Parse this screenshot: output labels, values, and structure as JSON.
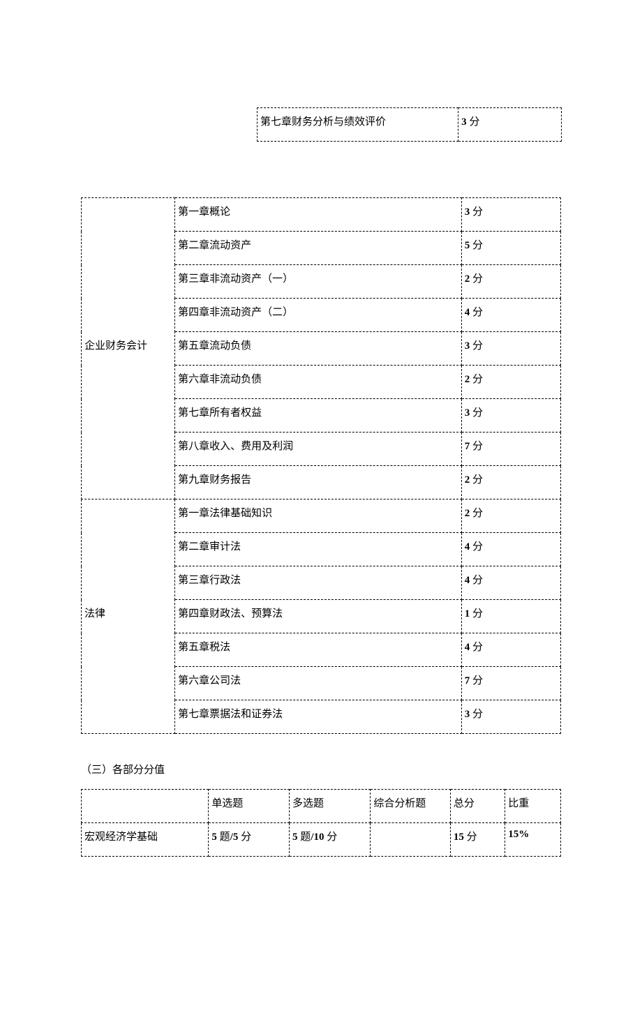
{
  "table1": {
    "rows": [
      {
        "chapter": "第七章财务分析与绩效评价",
        "score_num": "3",
        "score_suffix": " 分"
      }
    ]
  },
  "table2": {
    "section_a": {
      "category": "企业财务会计",
      "rows": [
        {
          "chapter": "第一章概论",
          "score_num": "3",
          "score_suffix": " 分"
        },
        {
          "chapter": "第二章流动资产",
          "score_num": "5",
          "score_suffix": " 分"
        },
        {
          "chapter": "第三章非流动资产（一）",
          "score_num": "2",
          "score_suffix": " 分"
        },
        {
          "chapter": "第四章非流动资产（二）",
          "score_num": "4",
          "score_suffix": " 分"
        },
        {
          "chapter": "第五章流动负债",
          "score_num": "3",
          "score_suffix": " 分"
        },
        {
          "chapter": "第六章非流动负债",
          "score_num": "2",
          "score_suffix": " 分"
        },
        {
          "chapter": "第七章所有者权益",
          "score_num": "3",
          "score_suffix": " 分"
        },
        {
          "chapter": "第八章收入、费用及利润",
          "score_num": "7",
          "score_suffix": " 分"
        },
        {
          "chapter": "第九章财务报告",
          "score_num": "2",
          "score_suffix": " 分"
        }
      ]
    },
    "section_b": {
      "category": "法律",
      "rows": [
        {
          "chapter": "第一章法律基础知识",
          "score_num": "2",
          "score_suffix": " 分"
        },
        {
          "chapter": "第二章审计法",
          "score_num": "4",
          "score_suffix": " 分"
        },
        {
          "chapter": "第三章行政法",
          "score_num": "4",
          "score_suffix": " 分"
        },
        {
          "chapter": "第四章财政法、预算法",
          "score_num": "1",
          "score_suffix": " 分"
        },
        {
          "chapter": "第五章税法",
          "score_num": "4",
          "score_suffix": " 分"
        },
        {
          "chapter": "第六章公司法",
          "score_num": "7",
          "score_suffix": " 分"
        },
        {
          "chapter": "第七章票据法和证券法",
          "score_num": "3",
          "score_suffix": " 分"
        }
      ]
    }
  },
  "section3": {
    "heading": "（三）各部分分值",
    "header": {
      "c0": "",
      "c1": "单选题",
      "c2": "多选题",
      "c3": "综合分析题",
      "c4": "总分",
      "c5": "比重"
    },
    "rows": [
      {
        "c0": "宏观经济学基础",
        "c1_a": "5",
        "c1_mid": " 题",
        "c1_b": "/5",
        "c1_suf": " 分",
        "c2_a": "5",
        "c2_mid": " 题",
        "c2_b": "/10",
        "c2_suf": " 分",
        "c3": "",
        "c4_a": "15",
        "c4_suf": " 分",
        "c5": "15%"
      }
    ]
  }
}
